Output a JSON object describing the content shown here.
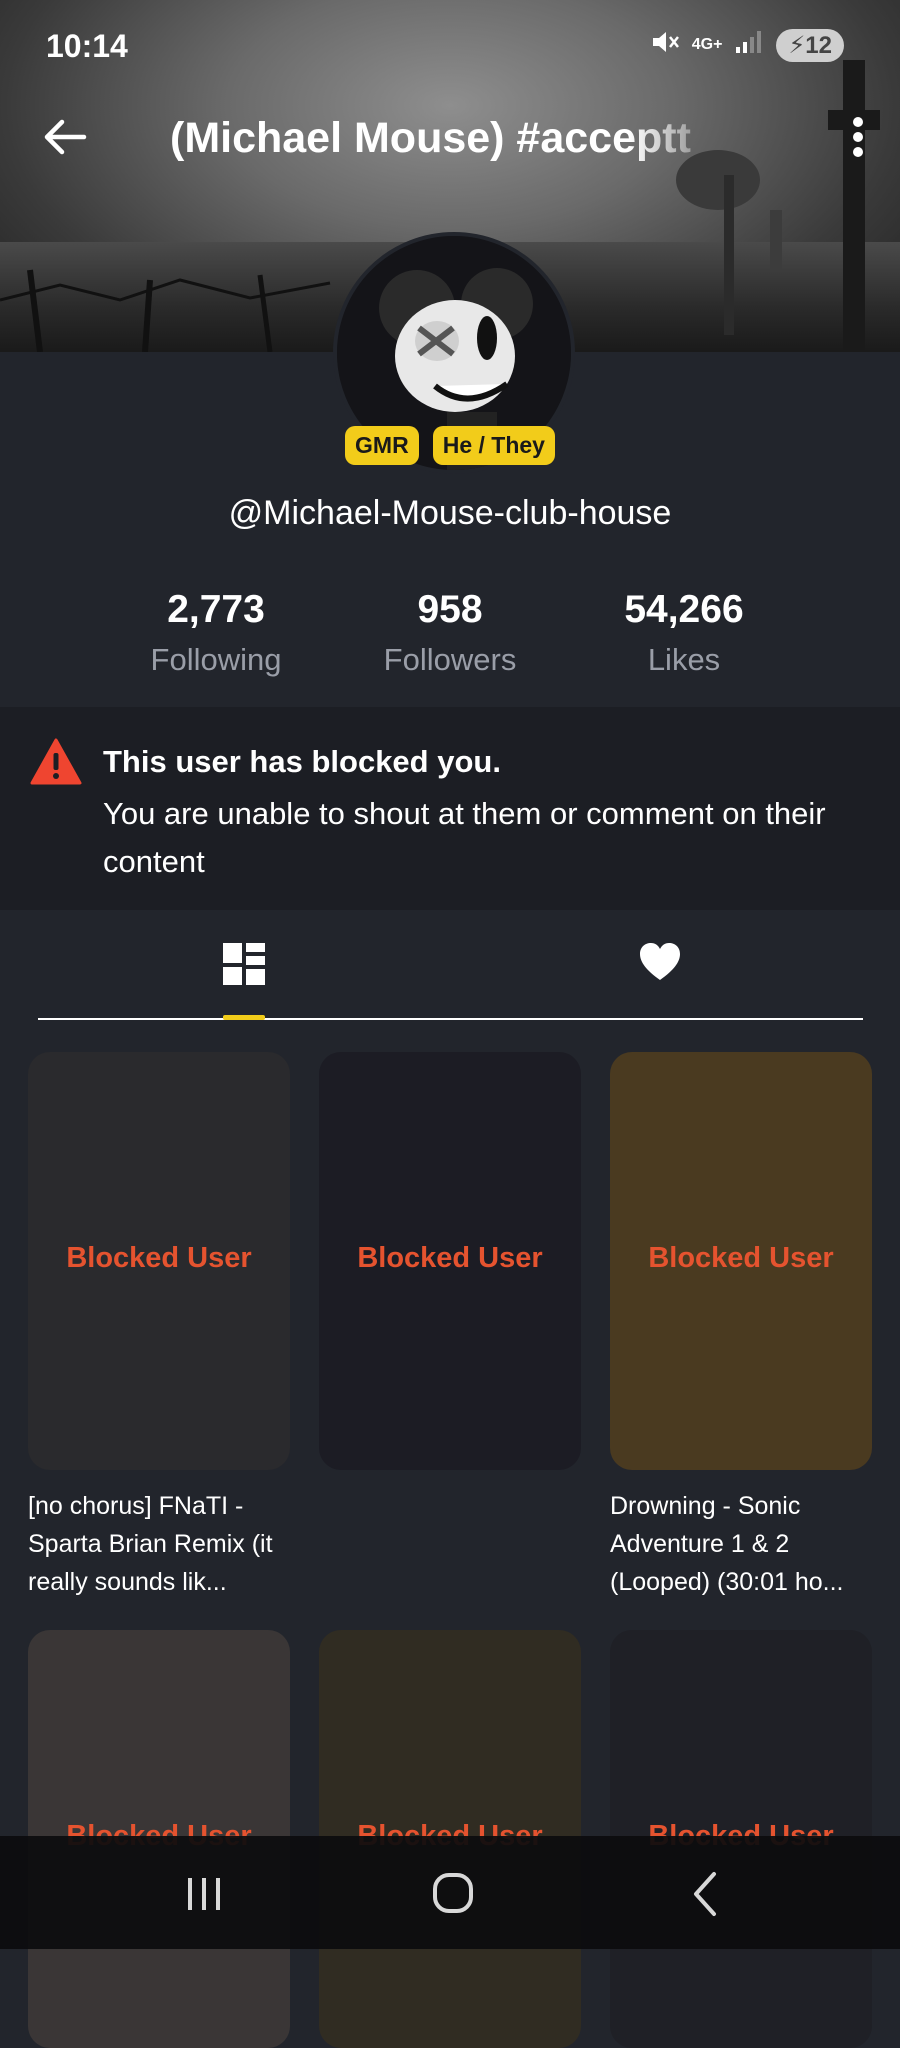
{
  "status_bar": {
    "time": "10:14",
    "network": "4G+",
    "battery": "12"
  },
  "header": {
    "title": "(Michael Mouse) #acceptt"
  },
  "profile": {
    "badges": [
      "GMR",
      "He / They"
    ],
    "username": "@Michael-Mouse-club-house",
    "stats": [
      {
        "value": "2,773",
        "label": "Following"
      },
      {
        "value": "958",
        "label": "Followers"
      },
      {
        "value": "54,266",
        "label": "Likes"
      }
    ]
  },
  "blocked_notice": {
    "title": "This user has blocked you.",
    "message": "You are unable to shout at them or comment on their content"
  },
  "tabs": [
    {
      "icon": "grid-icon",
      "active": true
    },
    {
      "icon": "heart-icon",
      "active": false
    }
  ],
  "cards": [
    {
      "label": "Blocked User",
      "color": "#2a2a2d",
      "caption": "[no chorus] FNaTI - Sparta Brian Remix (it really sounds lik..."
    },
    {
      "label": "Blocked User",
      "color": "#1c1c24",
      "caption": ""
    },
    {
      "label": "Blocked User",
      "color": "#4a3a20",
      "caption": "Drowning - Sonic Adventure 1 & 2 (Looped) (30:01 ho..."
    },
    {
      "label": "Blocked User",
      "color": "#3a3636",
      "caption": ""
    },
    {
      "label": "Blocked User",
      "color": "#302c22",
      "caption": ""
    },
    {
      "label": "Blocked User",
      "color": "#1f2026",
      "caption": ""
    }
  ],
  "colors": {
    "accent_yellow": "#f2cc1a",
    "blocked_red": "#e5532f",
    "background": "#22252c",
    "warning_red": "#ef4530"
  }
}
